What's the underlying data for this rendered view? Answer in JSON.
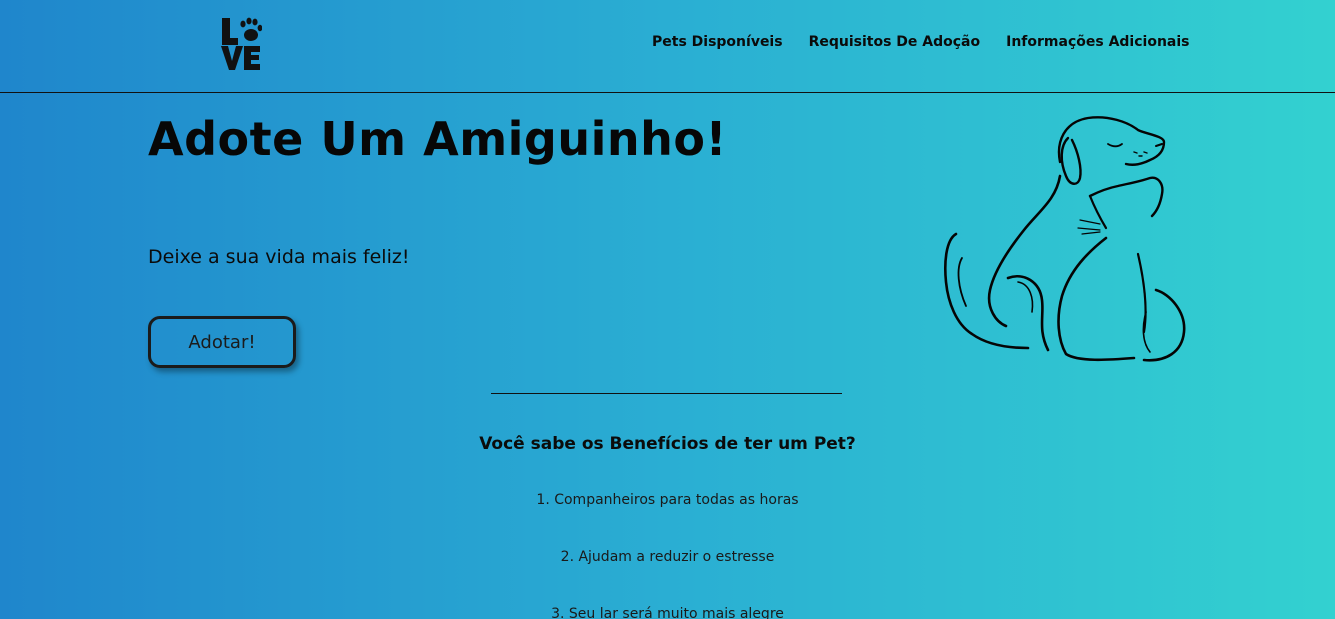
{
  "header": {
    "logo_alt": "LOVE",
    "nav": [
      {
        "label": "Pets Disponíveis"
      },
      {
        "label": "Requisitos De Adoção"
      },
      {
        "label": "Informações Adicionais"
      }
    ]
  },
  "hero": {
    "title": "Adote Um Amiguinho!",
    "subtitle": "Deixe a sua vida mais feliz!",
    "button_label": "Adotar!"
  },
  "benefits": {
    "title": "Você sabe os Benefícios de ter um Pet?",
    "items": [
      "1. Companheiros para todas as horas",
      "2. Ajudam a reduzir o estresse",
      "3. Seu lar será muito mais alegre"
    ]
  },
  "colors": {
    "gradient_start": "#1f86cc",
    "gradient_end": "#33d1d0",
    "text": "#0b0b0b"
  },
  "icons": {
    "logo": "love-paw-logo-icon",
    "illustration": "dog-and-cat-outline-illustration"
  }
}
